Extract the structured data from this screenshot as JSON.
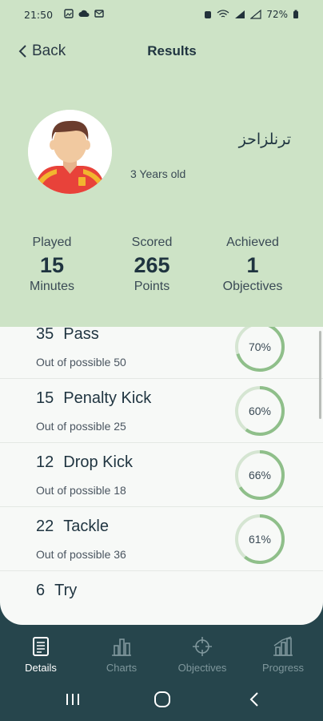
{
  "status_bar": {
    "time": "21:50",
    "battery": "72%"
  },
  "header": {
    "back_label": "Back",
    "title": "Results"
  },
  "player": {
    "name": "ترنلزاحز",
    "age": "3 Years old"
  },
  "stats": [
    {
      "label": "Played",
      "value": "15",
      "unit": "Minutes"
    },
    {
      "label": "Scored",
      "value": "265",
      "unit": "Points"
    },
    {
      "label": "Achieved",
      "value": "1",
      "unit": "Objectives"
    }
  ],
  "items": [
    {
      "count": "35",
      "name": "Pass",
      "sub": "Out of possible 50",
      "percent_label": "70%",
      "percent": 70
    },
    {
      "count": "15",
      "name": "Penalty Kick",
      "sub": "Out of possible 25",
      "percent_label": "60%",
      "percent": 60
    },
    {
      "count": "12",
      "name": "Drop Kick",
      "sub": "Out of possible 18",
      "percent_label": "66%",
      "percent": 66
    },
    {
      "count": "22",
      "name": "Tackle",
      "sub": "Out of possible 36",
      "percent_label": "61%",
      "percent": 61
    },
    {
      "count": "6",
      "name": "Try",
      "sub": "",
      "percent_label": "",
      "percent": 0
    }
  ],
  "nav": [
    {
      "label": "Details",
      "icon": "document-icon",
      "active": true
    },
    {
      "label": "Charts",
      "icon": "bar-chart-icon",
      "active": false
    },
    {
      "label": "Objectives",
      "icon": "target-icon",
      "active": false
    },
    {
      "label": "Progress",
      "icon": "progress-chart-icon",
      "active": false
    }
  ],
  "colors": {
    "header_bg": "#cde3c6",
    "nav_bg": "#26454c",
    "ring_track": "#d5e5d2",
    "ring_fill": "#8fbf8a"
  }
}
